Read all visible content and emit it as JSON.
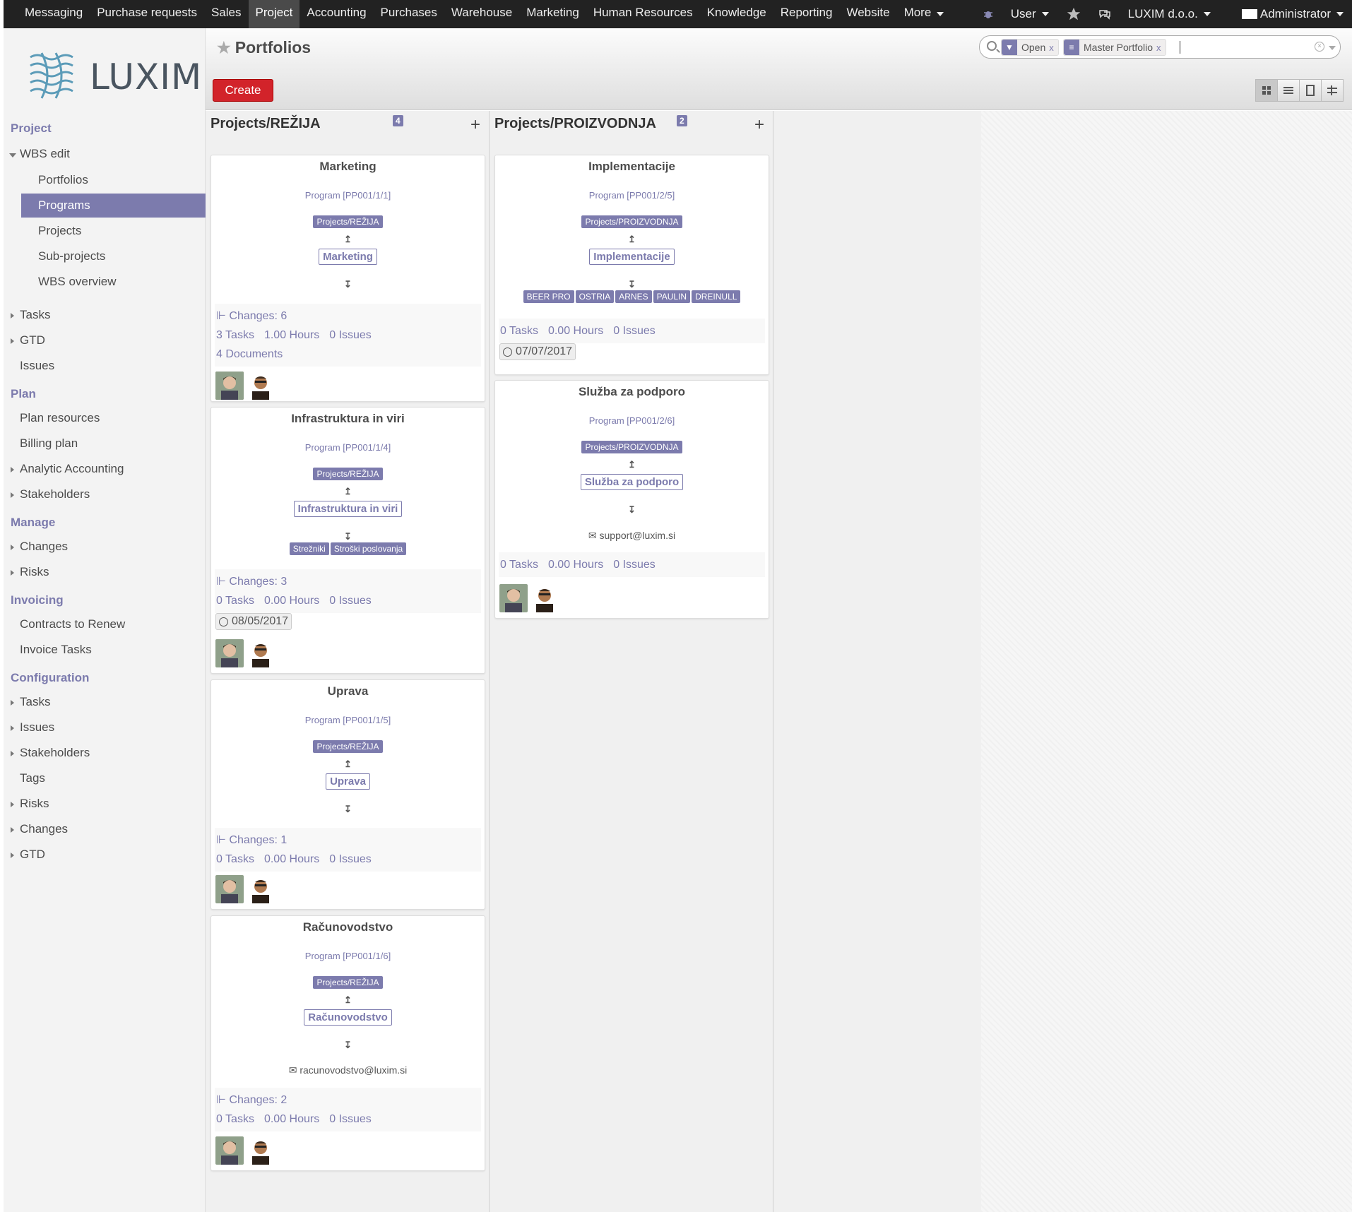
{
  "topbar": {
    "menu": [
      "Messaging",
      "Purchase requests",
      "Sales",
      "Project",
      "Accounting",
      "Purchases",
      "Warehouse",
      "Marketing",
      "Human Resources",
      "Knowledge",
      "Reporting",
      "Website",
      "More"
    ],
    "active": "Project",
    "user_label": "User",
    "company": "LUXIM d.o.o.",
    "admin": "Administrator"
  },
  "sidebar": {
    "logo_text": "LUXIM",
    "sections": {
      "project": "Project",
      "plan": "Plan",
      "manage": "Manage",
      "invoicing": "Invoicing",
      "configuration": "Configuration"
    },
    "items": {
      "wbs_edit": "WBS edit",
      "portfolios": "Portfolios",
      "programs": "Programs",
      "projects": "Projects",
      "sub_projects": "Sub-projects",
      "wbs_overview": "WBS overview",
      "tasks": "Tasks",
      "gtd": "GTD",
      "issues": "Issues",
      "plan_resources": "Plan resources",
      "billing_plan": "Billing plan",
      "analytic_accounting": "Analytic Accounting",
      "stakeholders": "Stakeholders",
      "changes": "Changes",
      "risks": "Risks",
      "contracts_to_renew": "Contracts to Renew",
      "invoice_tasks": "Invoice Tasks",
      "cfg_tasks": "Tasks",
      "cfg_issues": "Issues",
      "cfg_stakeholders": "Stakeholders",
      "cfg_tags": "Tags",
      "cfg_risks": "Risks",
      "cfg_changes": "Changes",
      "cfg_gtd": "GTD"
    }
  },
  "control": {
    "title": "Portfolios",
    "create_label": "Create",
    "facets": [
      "Open",
      "Master Portfolio"
    ]
  },
  "columns": [
    {
      "title": "Projects/REŽIJA",
      "count": "4",
      "cards": [
        {
          "name": "Marketing",
          "code": "Program [PP001/1/1]",
          "parent": "Projects/REŽIJA",
          "self": "Marketing",
          "changes": "Changes: 6",
          "tasks": "3 Tasks",
          "hours": "1.00 Hours",
          "issues": "0 Issues",
          "documents": "4 Documents"
        },
        {
          "name": "Infrastruktura in viri",
          "code": "Program [PP001/1/4]",
          "parent": "Projects/REŽIJA",
          "self": "Infrastruktura in viri",
          "children": [
            "Strežniki",
            "Stroški poslovanja"
          ],
          "changes": "Changes: 3",
          "tasks": "0 Tasks",
          "hours": "0.00 Hours",
          "issues": "0 Issues",
          "date": "08/05/2017"
        },
        {
          "name": "Uprava",
          "code": "Program [PP001/1/5]",
          "parent": "Projects/REŽIJA",
          "self": "Uprava",
          "changes": "Changes: 1",
          "tasks": "0 Tasks",
          "hours": "0.00 Hours",
          "issues": "0 Issues"
        },
        {
          "name": "Računovodstvo",
          "code": "Program [PP001/1/6]",
          "parent": "Projects/REŽIJA",
          "self": "Računovodstvo",
          "email": "racunovodstvo@luxim.si",
          "changes": "Changes: 2",
          "tasks": "0 Tasks",
          "hours": "0.00 Hours",
          "issues": "0 Issues"
        }
      ]
    },
    {
      "title": "Projects/PROIZVODNJA",
      "count": "2",
      "cards": [
        {
          "name": "Implementacije",
          "code": "Program [PP001/2/5]",
          "parent": "Projects/PROIZVODNJA",
          "self": "Implementacije",
          "children": [
            "BEER PRO",
            "OSTRIA",
            "ARNES",
            "PAULIN",
            "DREINULL"
          ],
          "tasks": "0 Tasks",
          "hours": "0.00 Hours",
          "issues": "0 Issues",
          "date": "07/07/2017"
        },
        {
          "name": "Služba za podporo",
          "code": "Program [PP001/2/6]",
          "parent": "Projects/PROIZVODNJA",
          "self": "Služba za podporo",
          "email": "support@luxim.si",
          "tasks": "0 Tasks",
          "hours": "0.00 Hours",
          "issues": "0 Issues"
        }
      ]
    }
  ],
  "colors": {
    "accent": "#7c7bad",
    "topbar": "#222222",
    "create": "#d2232a"
  },
  "arrows": {
    "up": "↥",
    "down": "↧"
  }
}
